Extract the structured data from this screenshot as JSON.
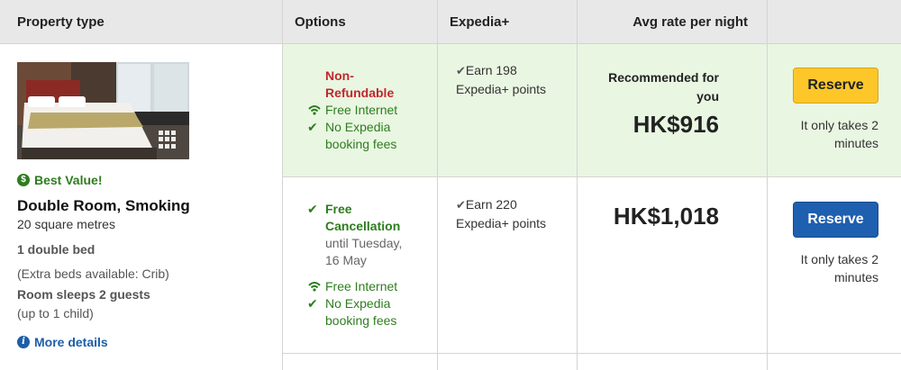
{
  "header": {
    "property_type": "Property type",
    "options": "Options",
    "expedia_plus": "Expedia+",
    "avg_rate": "Avg rate per night"
  },
  "room": {
    "badge_icon": "dollar-circle-icon",
    "best_value": "Best Value!",
    "name": "Double Room, Smoking",
    "size": "20 square metres",
    "bed": "1 double bed",
    "extra_beds": "(Extra beds available: Crib)",
    "sleeps": "Room sleeps 2 guests",
    "children": "(up to 1 child)",
    "more_details": "More details",
    "more_details_icon": "info-circle-icon",
    "gallery_icon": "grid-gallery-icon"
  },
  "rates": [
    {
      "policy_line1": "Non-",
      "policy_line2": "Refundable",
      "internet": "Free Internet",
      "fees_line1": "No Expedia",
      "fees_line2": "booking fees",
      "points_line1": "Earn 198",
      "points_line2": "Expedia+ points",
      "recommended_line1": "Recommended for",
      "recommended_line2": "you",
      "price": "HK$916",
      "reserve": "Reserve",
      "takes_line1": "It only takes 2",
      "takes_line2": "minutes",
      "button_color": "#fdc72a"
    },
    {
      "policy_line1": "Free",
      "policy_line2": "Cancellation",
      "until_line1": "until Tuesday,",
      "until_line2": "16 May",
      "internet": "Free Internet",
      "fees_line1": "No Expedia",
      "fees_line2": "booking fees",
      "points_line1": "Earn 220",
      "points_line2": "Expedia+ points",
      "price": "HK$1,018",
      "reserve": "Reserve",
      "takes_line1": "It only takes 2",
      "takes_line2": "minutes",
      "button_color": "#1f5fb0"
    }
  ],
  "colors": {
    "recommended_row_bg": "#e9f6e2",
    "non_refundable": "#c0272d",
    "green_text": "#2e7d1e",
    "link_blue": "#1d5ea8"
  }
}
